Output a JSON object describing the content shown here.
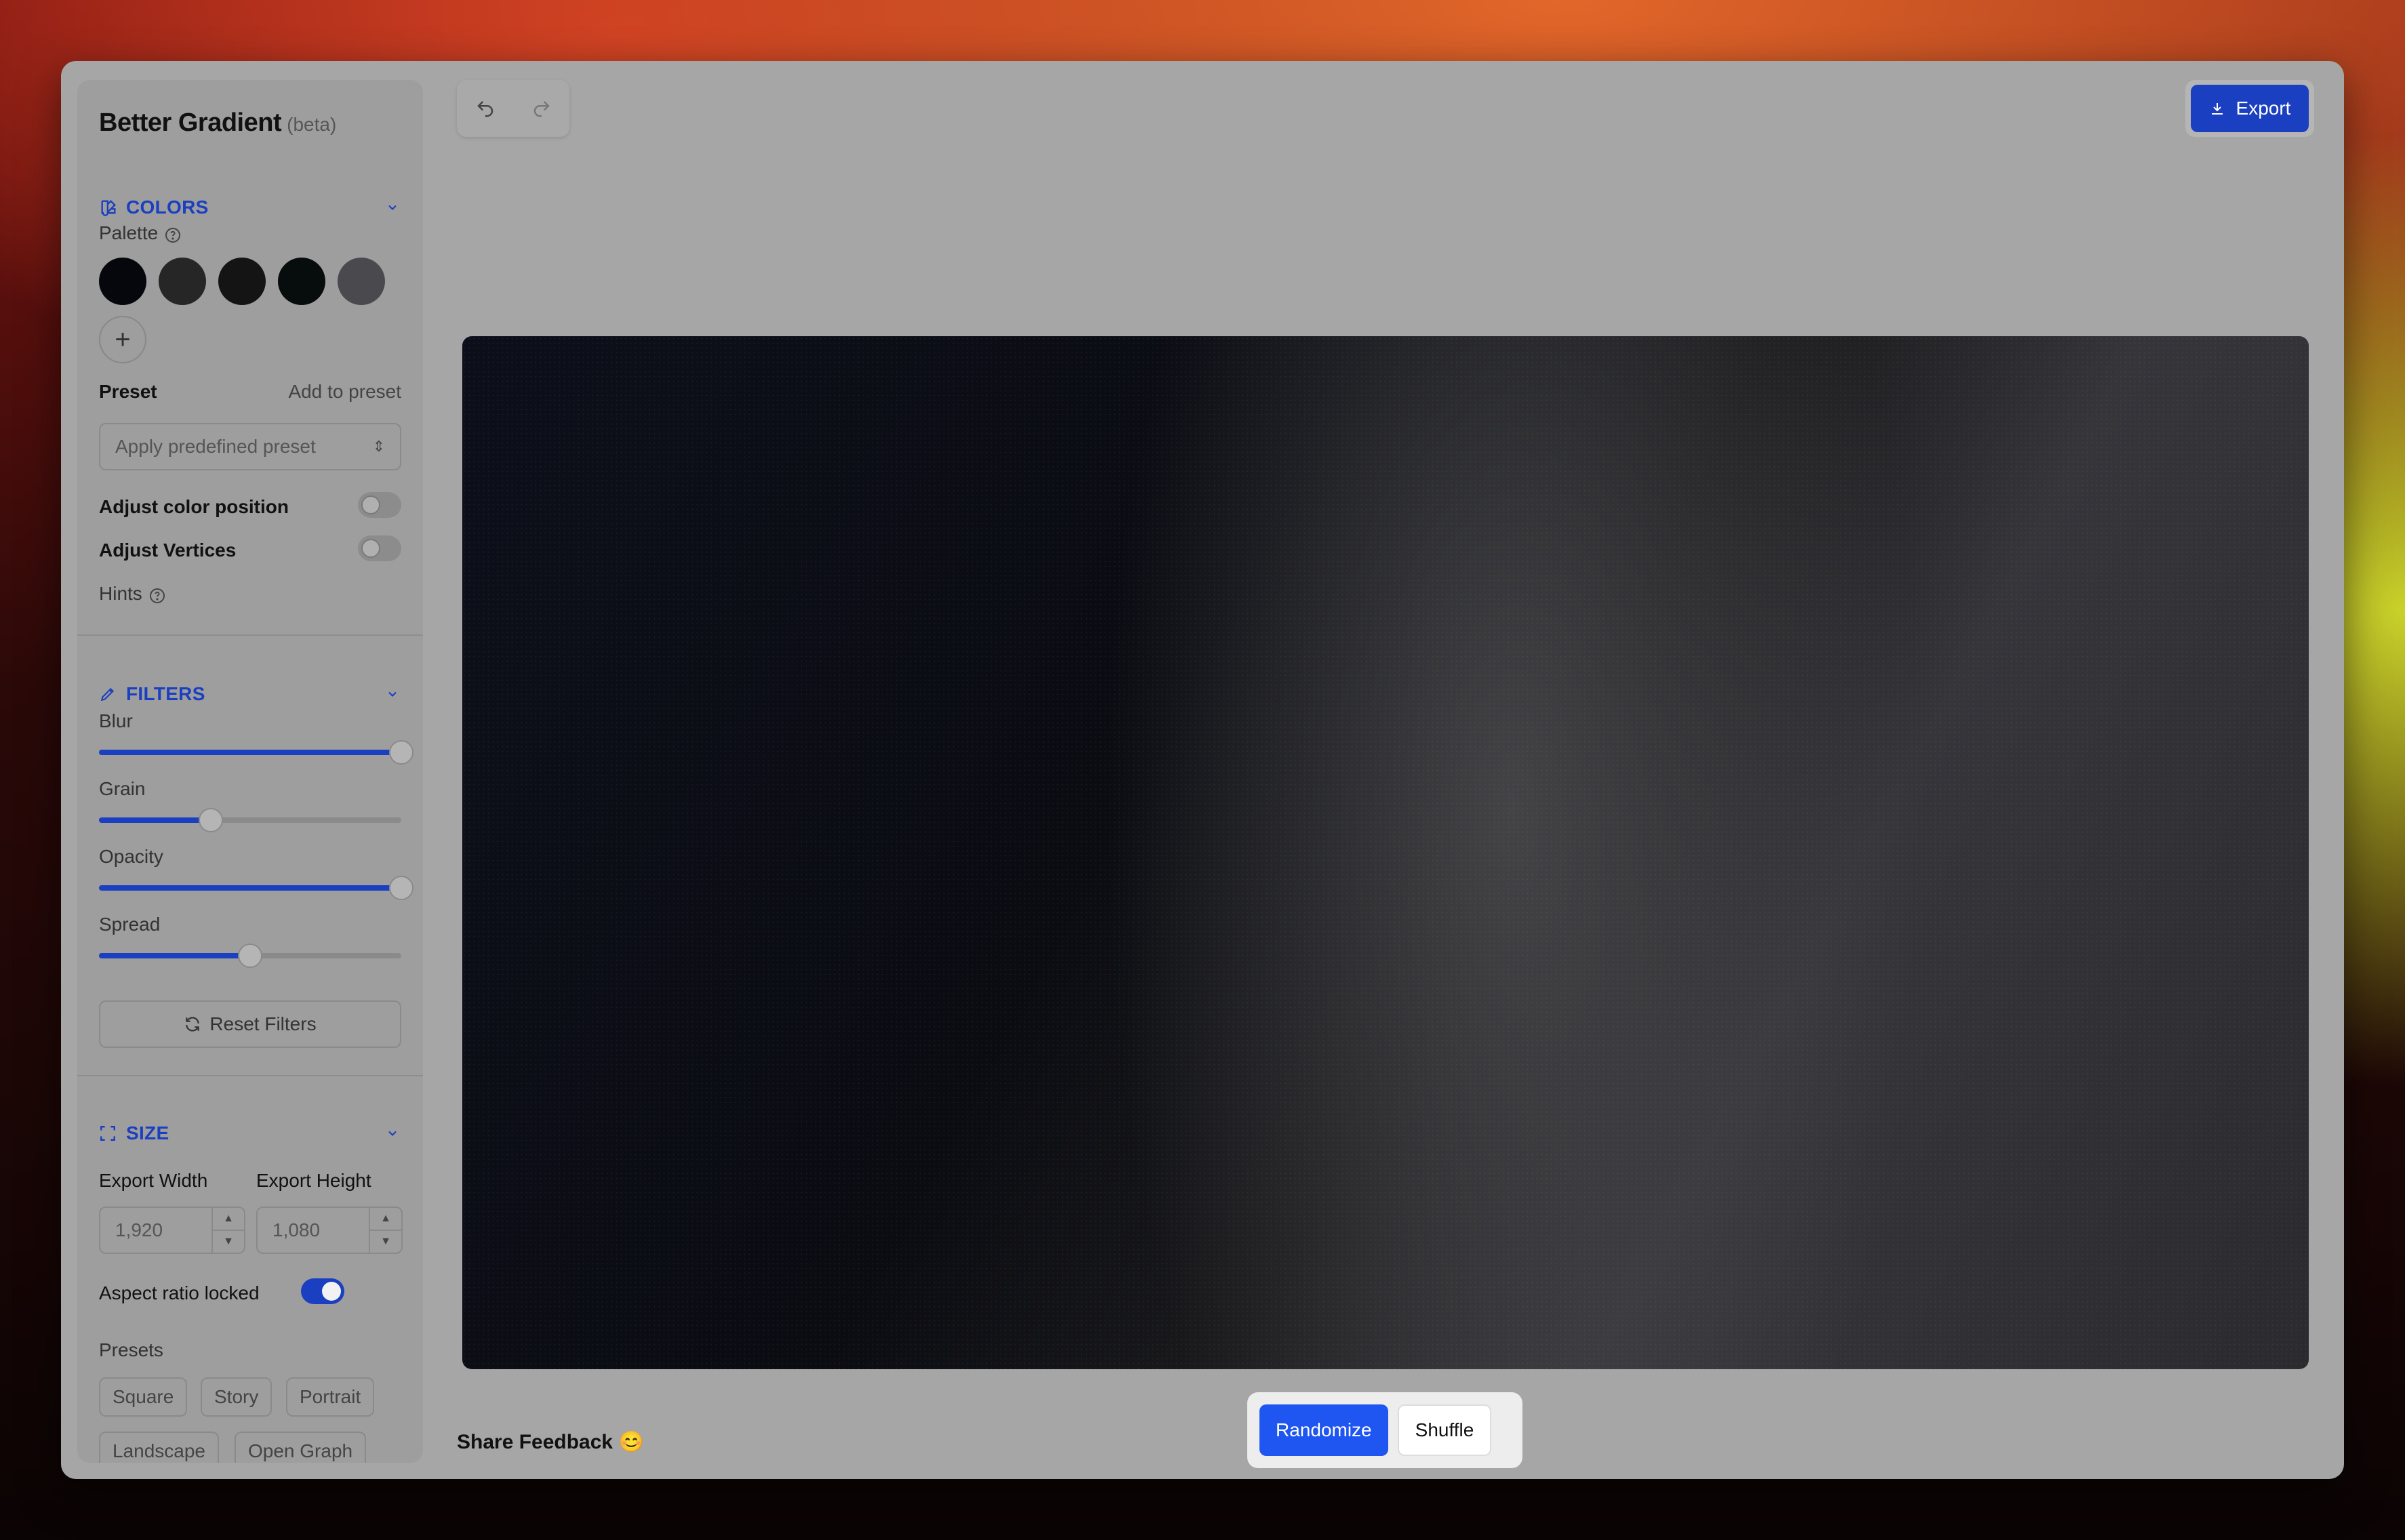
{
  "app": {
    "title": "Better Gradient",
    "badge": "(beta)"
  },
  "colors_section": {
    "title": "COLORS",
    "palette_label": "Palette",
    "swatches": [
      "#05070d",
      "#262626",
      "#141414",
      "#070c0c",
      "#4a4a4e"
    ],
    "preset_label": "Preset",
    "add_to_preset": "Add to preset",
    "preset_placeholder": "Apply predefined preset",
    "adjust_color_position": {
      "label": "Adjust color position",
      "on": false
    },
    "adjust_vertices": {
      "label": "Adjust Vertices",
      "on": false
    },
    "hints_label": "Hints"
  },
  "filters_section": {
    "title": "FILTERS",
    "sliders": [
      {
        "label": "Blur",
        "value": 1.0
      },
      {
        "label": "Grain",
        "value": 0.37
      },
      {
        "label": "Opacity",
        "value": 1.0
      },
      {
        "label": "Spread",
        "value": 0.5
      }
    ],
    "reset_label": "Reset Filters"
  },
  "size_section": {
    "title": "SIZE",
    "width_label": "Export Width",
    "height_label": "Export Height",
    "width_value": "1,920",
    "height_value": "1,080",
    "aspect_label": "Aspect ratio locked",
    "aspect_locked": true,
    "presets_label": "Presets",
    "presets": [
      "Square",
      "Story",
      "Portrait",
      "Landscape",
      "Open Graph"
    ]
  },
  "toolbar": {
    "export_label": "Export"
  },
  "footer": {
    "feedback_label": "Share Feedback 😊",
    "randomize_label": "Randomize",
    "shuffle_label": "Shuffle"
  },
  "colors": {
    "accent": "#1a3fc0",
    "randomize": "#1f56f2"
  }
}
